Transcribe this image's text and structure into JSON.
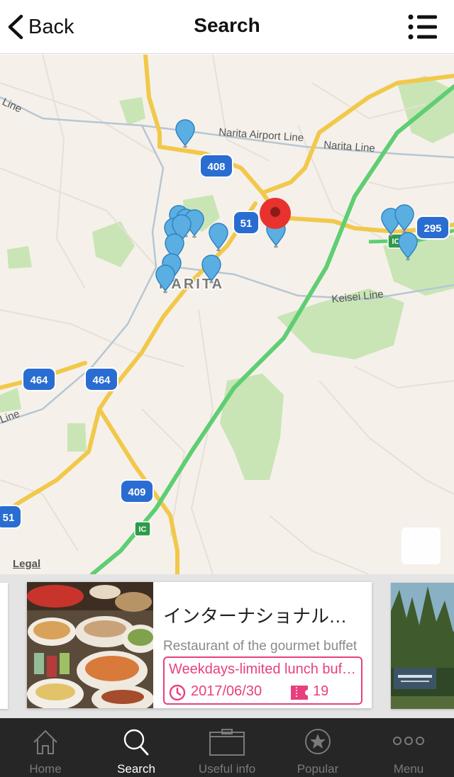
{
  "header": {
    "back_label": "Back",
    "title": "Search"
  },
  "map": {
    "road_labels": [
      "Narita Airport Line",
      "Narita Line",
      "Keisei Line",
      "Line",
      "Line"
    ],
    "route_shields": [
      "408",
      "51",
      "295",
      "464",
      "464",
      "409",
      "51"
    ],
    "interchange_badges": [
      "IC",
      "IC"
    ],
    "place_label": "NARITA",
    "legal_label": "Legal",
    "pin_color": "#5aaee2",
    "selected_pin_color": "#e8322e"
  },
  "card": {
    "title": "インターナショナルガーデンホテル成田",
    "description": "Restaurant of the gourmet buffet",
    "promo": "Weekdays-limited lunch buffet",
    "date": "2017/06/30",
    "coupon_count": "19",
    "accent_color": "#e8407e"
  },
  "tabs": [
    {
      "label": "Home",
      "icon": "home-icon"
    },
    {
      "label": "Search",
      "icon": "search-icon",
      "active": true
    },
    {
      "label": "Useful info",
      "icon": "info-box-icon"
    },
    {
      "label": "Popular",
      "icon": "star-icon"
    },
    {
      "label": "Menu",
      "icon": "more-icon"
    }
  ]
}
